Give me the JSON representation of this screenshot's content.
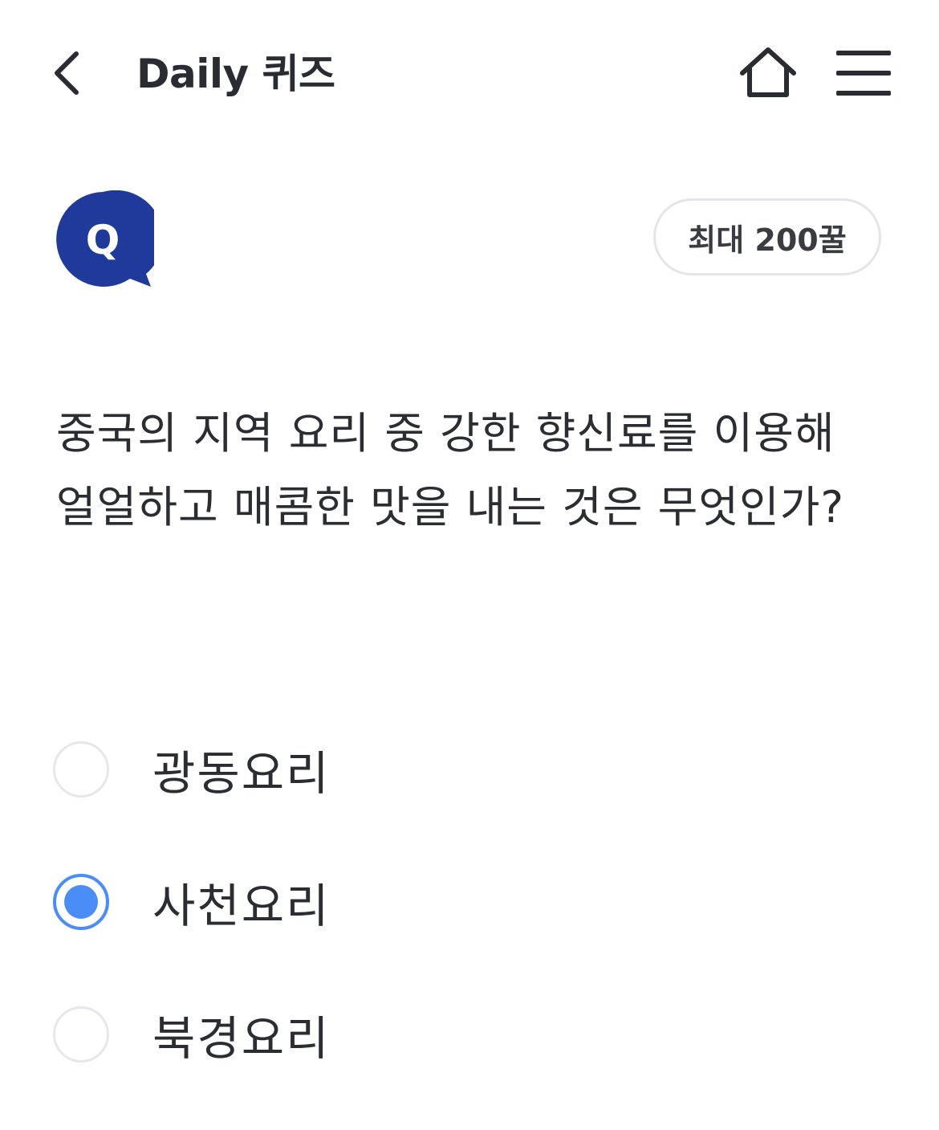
{
  "header": {
    "title": "Daily 퀴즈",
    "back_icon": "chevron-left-icon",
    "home_icon": "home-icon",
    "menu_icon": "hamburger-menu-icon"
  },
  "badge": {
    "letter": "Q",
    "color": "#1f3a9a"
  },
  "reward": {
    "label": "최대 200꿀"
  },
  "question": {
    "text": "중국의 지역 요리 중 강한 향신료를 이용해 얼얼하고 매콤한 맛을 내는 것은 무엇인가?"
  },
  "options": [
    {
      "label": "광동요리",
      "selected": false
    },
    {
      "label": "사천요리",
      "selected": true
    },
    {
      "label": "북경요리",
      "selected": false
    }
  ],
  "colors": {
    "accent": "#4a8df6",
    "text": "#2b2d33",
    "border": "#e6e7ea"
  }
}
